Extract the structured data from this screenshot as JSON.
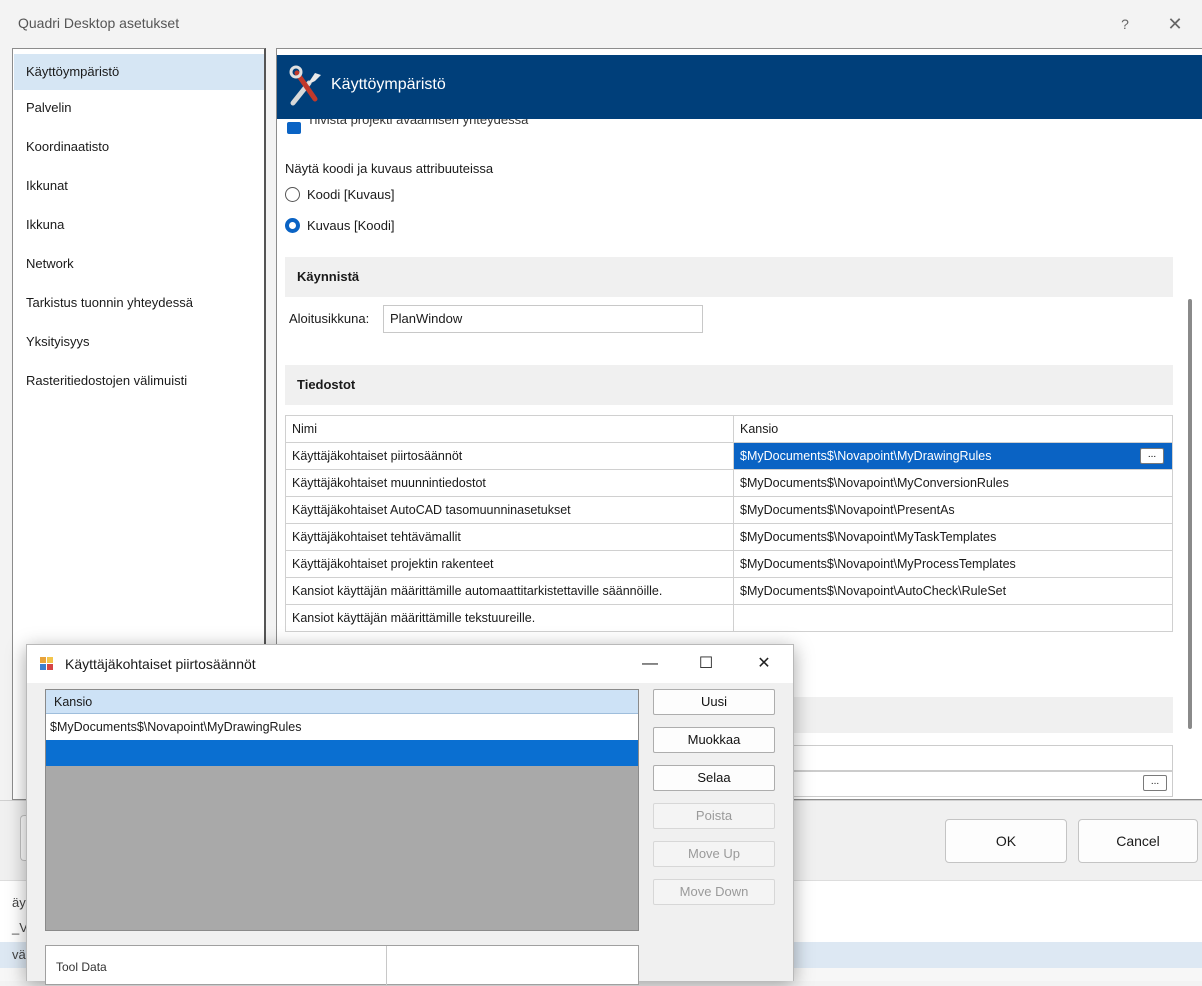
{
  "window": {
    "title": "Quadri Desktop asetukset",
    "help_label": "?",
    "close_label": "✕"
  },
  "nav": {
    "items": [
      {
        "label": "Käyttöympäristö",
        "selected": true
      },
      {
        "label": "Palvelin"
      },
      {
        "label": "Koordinaatisto"
      },
      {
        "label": "Ikkunat"
      },
      {
        "label": "Ikkuna"
      },
      {
        "label": "Network"
      },
      {
        "label": "Tarkistus tuonnin yhteydessä"
      },
      {
        "label": "Yksityisyys"
      },
      {
        "label": "Rasteritiedostojen välimuisti"
      }
    ]
  },
  "content": {
    "header_title": "Käyttöympäristö",
    "header_icon": "tools-icon",
    "cut_checkbox_text": "Tiivistä projekti avaamisen yhteydessä",
    "attr_label": "Näytä koodi ja kuvaus attribuuteissa",
    "radio_options": [
      {
        "label": "Koodi [Kuvaus]",
        "checked": false
      },
      {
        "label": "Kuvaus [Koodi]",
        "checked": true
      }
    ],
    "start_section": "Käynnistä",
    "start_label": "Aloitusikkuna:",
    "start_value": "PlanWindow",
    "files_section": "Tiedostot",
    "files_table": {
      "headers": [
        "Nimi",
        "Kansio"
      ],
      "rows": [
        {
          "name": "Käyttäjäkohtaiset piirtosäännöt",
          "folder": "$MyDocuments$\\Novapoint\\MyDrawingRules",
          "selected": true
        },
        {
          "name": "Käyttäjäkohtaiset muunnintiedostot",
          "folder": "$MyDocuments$\\Novapoint\\MyConversionRules"
        },
        {
          "name": "Käyttäjäkohtaiset AutoCAD tasomuunninasetukset",
          "folder": "$MyDocuments$\\Novapoint\\PresentAs"
        },
        {
          "name": "Käyttäjäkohtaiset tehtävämallit",
          "folder": "$MyDocuments$\\Novapoint\\MyTaskTemplates"
        },
        {
          "name": "Käyttäjäkohtaiset projektin rakenteet",
          "folder": "$MyDocuments$\\Novapoint\\MyProcessTemplates"
        },
        {
          "name": "Kansiot käyttäjän määrittämille automaattitarkistettaville säännöille.",
          "folder": "$MyDocuments$\\Novapoint\\AutoCheck\\RuleSet"
        },
        {
          "name": "Kansiot käyttäjän määrittämille tekstuureille.",
          "folder": ""
        }
      ],
      "ellipsis_label": "..."
    },
    "hidden_ellipsis_label": "..."
  },
  "buttons": {
    "ok": "OK",
    "cancel": "Cancel"
  },
  "background": {
    "strip1_text": "äy",
    "strip2_text": "_V",
    "strip3_text": "vä"
  },
  "dialog": {
    "title": "Käyttäjäkohtaiset piirtosäännöt",
    "minimize": "—",
    "maximize": "☐",
    "close": "✕",
    "list_header": "Kansio",
    "list_rows": [
      "$MyDocuments$\\Novapoint\\MyDrawingRules",
      ""
    ],
    "buttons": [
      {
        "label": "Uusi",
        "enabled": true
      },
      {
        "label": "Muokkaa",
        "enabled": true
      },
      {
        "label": "Selaa",
        "enabled": true
      },
      {
        "label": "Poista",
        "enabled": false
      },
      {
        "label": "Move Up",
        "enabled": false
      },
      {
        "label": "Move Down",
        "enabled": false
      }
    ],
    "bottom_text": "Tool Data"
  }
}
